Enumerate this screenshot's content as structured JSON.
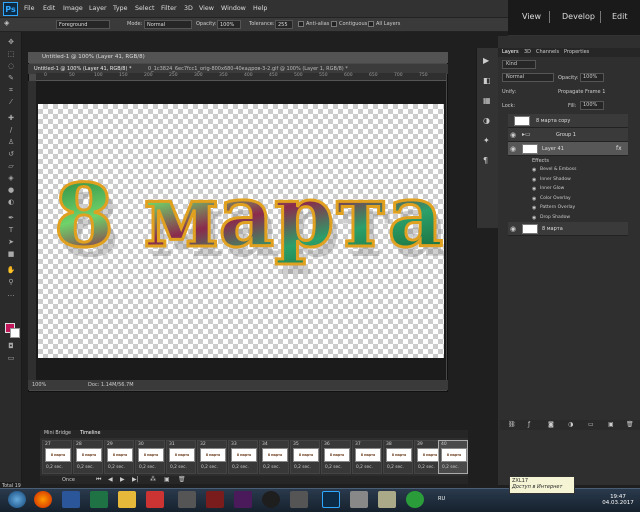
{
  "app": {
    "logo": "Ps"
  },
  "menu": [
    "File",
    "Edit",
    "Image",
    "Layer",
    "Type",
    "Select",
    "Filter",
    "3D",
    "View",
    "Window",
    "Help"
  ],
  "lightroom": {
    "view": "View",
    "develop": "Develop",
    "edit": "Edit"
  },
  "options": {
    "fill_source": "Foreground",
    "mode_label": "Mode:",
    "mode_value": "Normal",
    "opacity_label": "Opacity:",
    "opacity_value": "100%",
    "tolerance_label": "Tolerance:",
    "tolerance_value": "255",
    "anti_alias": "Anti-alias",
    "contiguous": "Contiguous",
    "all_layers": "All Layers"
  },
  "document": {
    "title": "Untitled-1 @ 100% (Layer 41, RGB/8)",
    "tab1": "Untitled-1 @ 100% (Layer 41, RGB/8) *",
    "tab2": "0_1c3824_6ec7fcc1_orig-800x680-40кадров-3-2.gif @ 100% (Layer 1, RGB/8) *",
    "canvas_text": "8 марта",
    "zoom": "100%",
    "doc_size": "Doc: 1.14M/56.7M",
    "ruler_ticks": [
      "0",
      "50",
      "100",
      "150",
      "200",
      "250",
      "300",
      "350",
      "400",
      "450",
      "500",
      "550",
      "600",
      "650",
      "700",
      "750"
    ]
  },
  "layers_panel": {
    "tabs": [
      "Layers",
      "3D",
      "Channels",
      "Properties"
    ],
    "kind": "Kind",
    "blend": "Normal",
    "opacity_label": "Opacity:",
    "opacity_value": "100%",
    "unify_label": "Unify:",
    "propagate": "Propagate Frame 1",
    "lock_label": "Lock:",
    "fill_label": "Fill:",
    "fill_value": "100%",
    "layers": [
      {
        "name": "8 марта copy"
      },
      {
        "name": "Group 1"
      },
      {
        "name": "Layer 41",
        "fx": "fx"
      },
      {
        "name": "8 марта"
      }
    ],
    "effects_label": "Effects",
    "effects": [
      "Bevel & Emboss",
      "Inner Shadow",
      "Inner Glow",
      "Color Overlay",
      "Pattern Overlay",
      "Drop Shadow"
    ]
  },
  "timeline": {
    "tabs": [
      "Mini Bridge",
      "Timeline"
    ],
    "frames": [
      {
        "n": "27",
        "delay": "0,2 sec."
      },
      {
        "n": "28",
        "delay": "0,2 sec."
      },
      {
        "n": "29",
        "delay": "0,2 sec."
      },
      {
        "n": "30",
        "delay": "0,2 sec."
      },
      {
        "n": "31",
        "delay": "0,2 sec."
      },
      {
        "n": "32",
        "delay": "0,2 sec."
      },
      {
        "n": "33",
        "delay": "0,2 sec."
      },
      {
        "n": "34",
        "delay": "0,2 sec."
      },
      {
        "n": "35",
        "delay": "0,2 sec."
      },
      {
        "n": "36",
        "delay": "0,2 sec."
      },
      {
        "n": "37",
        "delay": "0,2 sec."
      },
      {
        "n": "38",
        "delay": "0,2 sec."
      },
      {
        "n": "39",
        "delay": "0,2 sec."
      },
      {
        "n": "40",
        "delay": "0,2 sec."
      }
    ],
    "frame_thumb_text": "8 марта",
    "loop": "Once",
    "total": "Total 19"
  },
  "tooltip": {
    "line1": "ZXL17",
    "line2": "Доступ в Интернет"
  },
  "taskbar": {
    "lang": "RU",
    "time": "19:47",
    "date": "04.03.2017"
  },
  "colors": {
    "foreground": "#c2185b",
    "background": "#ffffff"
  }
}
